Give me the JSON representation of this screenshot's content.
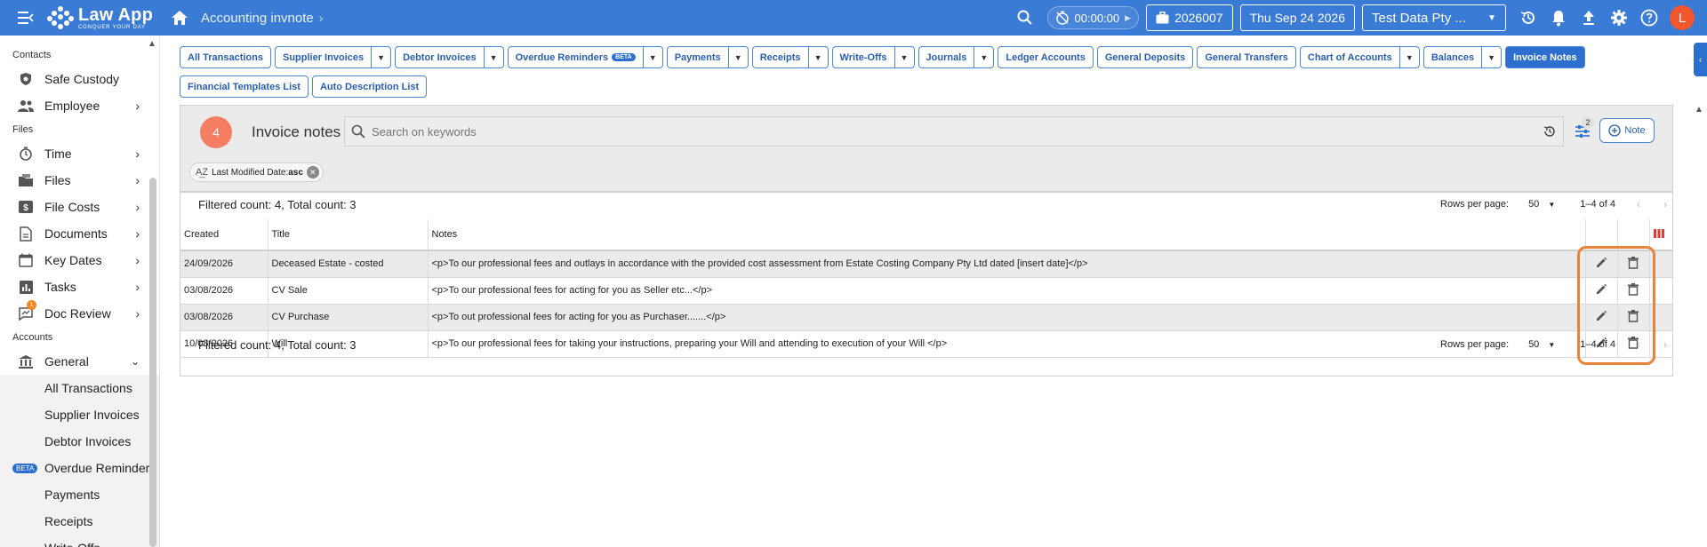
{
  "app": {
    "name": "Law App",
    "tagline": "CONQUER YOUR DAY",
    "breadcrumb": "Accounting invnote"
  },
  "topbar": {
    "timer": "00:00:00",
    "file_number": "2026007",
    "date": "Thu Sep 24 2026",
    "company": "Test Data Pty ...",
    "avatar_letter": "L"
  },
  "sidebar": {
    "sections": {
      "contacts": "Contacts",
      "files": "Files",
      "accounts": "Accounts"
    },
    "items": [
      {
        "label": "Safe Custody",
        "icon": "safe-custody-icon"
      },
      {
        "label": "Employee",
        "icon": "employee-icon"
      },
      {
        "label": "Time",
        "icon": "timer-icon"
      },
      {
        "label": "Files",
        "icon": "files-icon"
      },
      {
        "label": "File Costs",
        "icon": "dollar-icon"
      },
      {
        "label": "Documents",
        "icon": "document-icon"
      },
      {
        "label": "Key Dates",
        "icon": "calendar-icon"
      },
      {
        "label": "Tasks",
        "icon": "chart-icon"
      },
      {
        "label": "Doc Review",
        "icon": "review-icon",
        "badge": "1"
      },
      {
        "label": "General",
        "icon": "bank-icon"
      }
    ],
    "sub_items": [
      {
        "label": "All Transactions"
      },
      {
        "label": "Supplier Invoices"
      },
      {
        "label": "Debtor Invoices"
      },
      {
        "label": "Overdue Reminder",
        "badge": "BETA"
      },
      {
        "label": "Payments"
      },
      {
        "label": "Receipts"
      },
      {
        "label": "Write-Offs"
      }
    ]
  },
  "tabs": {
    "row1": [
      {
        "label": "All Transactions",
        "dropdown": false
      },
      {
        "label": "Supplier Invoices",
        "dropdown": true
      },
      {
        "label": "Debtor Invoices",
        "dropdown": true
      },
      {
        "label": "Overdue Reminders",
        "badge": "BETA",
        "dropdown": true
      },
      {
        "label": "Payments",
        "dropdown": true
      },
      {
        "label": "Receipts",
        "dropdown": true
      },
      {
        "label": "Write-Offs",
        "dropdown": true
      },
      {
        "label": "Journals",
        "dropdown": true
      },
      {
        "label": "Ledger Accounts",
        "dropdown": false
      },
      {
        "label": "General Deposits",
        "dropdown": false
      },
      {
        "label": "General Transfers",
        "dropdown": false
      },
      {
        "label": "Chart of Accounts",
        "dropdown": true
      },
      {
        "label": "Balances",
        "dropdown": true
      },
      {
        "label": "Invoice Notes",
        "dropdown": false,
        "active": true
      }
    ],
    "row2": [
      {
        "label": "Financial Templates List"
      },
      {
        "label": "Auto Description List"
      }
    ]
  },
  "panel": {
    "count": "4",
    "title": "Invoice notes",
    "search_placeholder": "Search on keywords",
    "filter_count": "2",
    "note_button": "Note",
    "sort_chip_label": "Last Modified Date:",
    "sort_chip_value": "asc"
  },
  "table": {
    "filtered_text": "Filtered count: 4, Total count: 3",
    "rows_per_page_label": "Rows per page:",
    "rows_per_page": "50",
    "range": "1–4 of 4",
    "columns": [
      "Created",
      "Title",
      "Notes"
    ],
    "rows": [
      {
        "created": "24/09/2026",
        "title": "Deceased Estate - costed",
        "notes": "<p>To our professional fees and outlays in accordance with the provided cost assessment from Estate Costing Company Pty Ltd dated [insert date]</p>"
      },
      {
        "created": "03/08/2026",
        "title": "CV Sale",
        "notes": "<p>To our professional fees for acting for you as Seller etc...</p>"
      },
      {
        "created": "03/08/2026",
        "title": "CV Purchase",
        "notes": "<p>To out professional fees for acting for you as Purchaser.......</p>"
      },
      {
        "created": "10/08/2026",
        "title": "Will",
        "notes": "<p>To our professional fees for taking your instructions, preparing your Will and attending to execution of your Will   </p>"
      }
    ]
  },
  "colors": {
    "topbar": "#3a7bd5",
    "accent": "#2d6fcf",
    "avatar": "#f2572e",
    "count_circle": "#f47d62",
    "highlight": "#e8843a"
  }
}
